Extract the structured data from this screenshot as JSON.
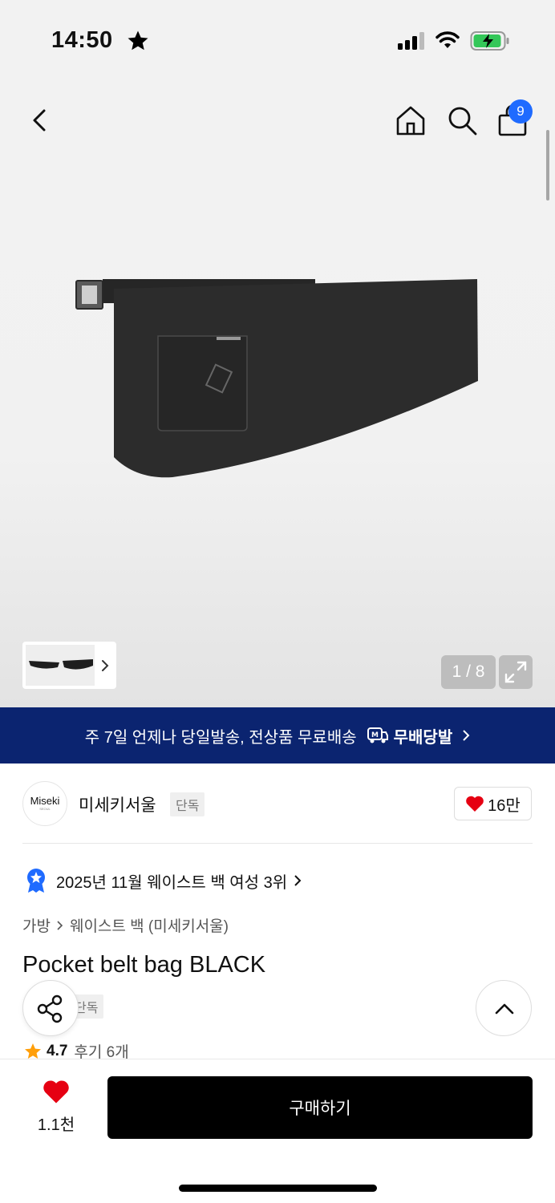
{
  "status": {
    "time": "14:50"
  },
  "nav": {
    "cart_count": "9"
  },
  "gallery": {
    "counter": "1 / 8"
  },
  "promo": {
    "text": "주 7일 언제나 당일발송, 전상품 무료배송",
    "brand": "무배당발"
  },
  "seller": {
    "logo_line1": "Miseki",
    "logo_line2": "SEOUL",
    "name": "미세키서울",
    "badge": "단독",
    "likes": "16만"
  },
  "ranking": {
    "text": "2025년 11월 웨이스트 백 여성 3위"
  },
  "breadcrumb": {
    "level1": "가방",
    "level2": "웨이스트 백 (미세키서울)"
  },
  "product": {
    "title": "Pocket belt bag BLACK",
    "badge": "단독",
    "rating": "4.7",
    "reviews": "후기 6개"
  },
  "bottom": {
    "fav_count": "1.1천",
    "buy_label": "구매하기"
  },
  "colors": {
    "accent_blue": "#1f6bff",
    "promo_bg": "#0b2470",
    "heart": "#e60012",
    "star": "#ff9f0a"
  }
}
